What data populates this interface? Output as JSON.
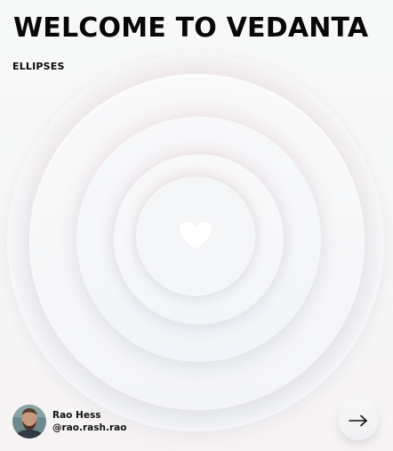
{
  "header": {
    "title": "WELCOME TO VEDANTA",
    "subtitle": "ELLIPSES"
  },
  "center": {
    "icon": "heart-icon"
  },
  "author": {
    "name": "Rao Hess",
    "handle": "@rao.rash.rao",
    "avatar": "avatar"
  },
  "navigation": {
    "next_icon": "arrow-right-icon"
  },
  "colors": {
    "background": "#f6f7f8",
    "text": "#080808",
    "heart": "#ffffff",
    "ring_glow_warm": "#e9d2d7",
    "ring_glow_cool": "#bec8d7"
  }
}
